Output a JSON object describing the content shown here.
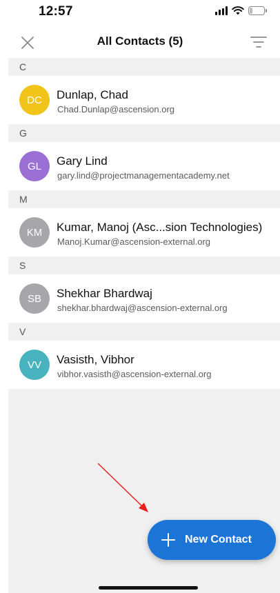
{
  "status_bar": {
    "time": "12:57",
    "battery": "23"
  },
  "header": {
    "title": "All Contacts (5)"
  },
  "sections": [
    {
      "letter": "C",
      "contacts": [
        {
          "initials": "DC",
          "name": "Dunlap, Chad",
          "email": "Chad.Dunlap@ascension.org",
          "color": "#f0c419"
        }
      ]
    },
    {
      "letter": "G",
      "contacts": [
        {
          "initials": "GL",
          "name": "Gary Lind",
          "email": "gary.lind@projectmanagementacademy.net",
          "color": "#9c6fd6"
        }
      ]
    },
    {
      "letter": "M",
      "contacts": [
        {
          "initials": "KM",
          "name": "Kumar, Manoj (Asc...sion Technologies)",
          "email": "Manoj.Kumar@ascension-external.org",
          "color": "#a6a6ab"
        }
      ]
    },
    {
      "letter": "S",
      "contacts": [
        {
          "initials": "SB",
          "name": "Shekhar Bhardwaj",
          "email": "shekhar.bhardwaj@ascension-external.org",
          "color": "#a6a6ab"
        }
      ]
    },
    {
      "letter": "V",
      "contacts": [
        {
          "initials": "VV",
          "name": "Vasisth, Vibhor",
          "email": "vibhor.vasisth@ascension-external.org",
          "color": "#48b3bf"
        }
      ]
    }
  ],
  "fab": {
    "label": "New Contact"
  },
  "colors": {
    "accent": "#1b74d6",
    "annotation": "#e8211c"
  },
  "icons": [
    "close-icon",
    "filter-icon",
    "plus-icon",
    "signal-icon",
    "wifi-icon",
    "battery-icon"
  ]
}
